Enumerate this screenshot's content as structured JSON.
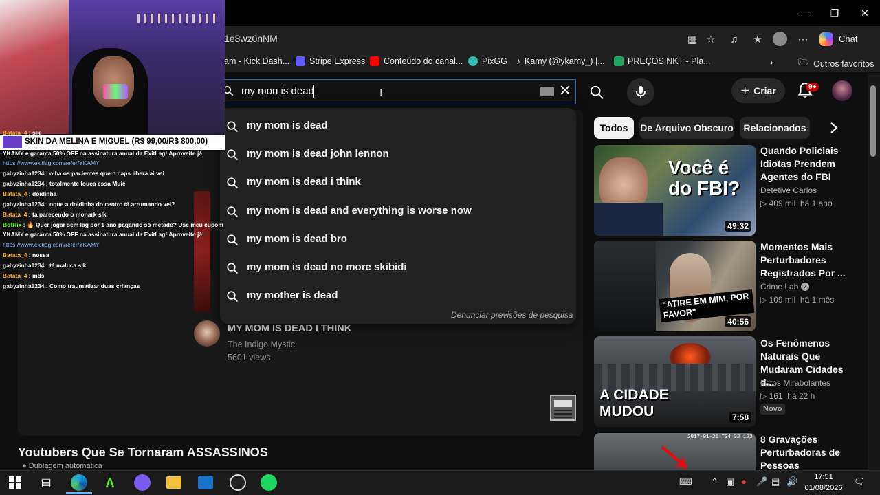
{
  "browser": {
    "url": "1e8wz0nNM",
    "chat_label": "Chat",
    "bookmarks": [
      "am - Kick Dash...",
      "Stripe Express",
      "Conteúdo do canal...",
      "PixGG",
      "Kamy (@ykamy_) |...",
      "PREÇOS NKT - Pla...",
      "Outros favoritos"
    ],
    "bookmark_colors": [
      "#53fc18",
      "#635bff",
      "#ff0000",
      "#32bcad",
      "#ffffff",
      "#1fa463",
      "#e6e6e6"
    ]
  },
  "youtube": {
    "search_value": "my mon is dead",
    "create_label": "Criar",
    "notification_badge": "9+",
    "suggestions": [
      "my mom is dead",
      "my mom is dead john lennon",
      "my mom is dead i think",
      "my mom is dead and everything is worse now",
      "my mom is dead bro",
      "my mom is dead no more skibidi",
      "my mother is dead"
    ],
    "report_link": "Denunciar previsões de pesquisa",
    "video": {
      "title": "MY MOM IS DEAD I THINK",
      "channel": "The Indigo Mystic",
      "views": "5601 views"
    },
    "section_title": "Youtubers Que Se Tornaram ASSASSINOS",
    "section_sub": "Dublagem automática",
    "chips": [
      "Todos",
      "De Arquivo Obscuro",
      "Relacionados"
    ],
    "recommended": [
      {
        "title": "Quando Policiais Idiotas Prendem Agentes do FBI",
        "channel": "Detetive Carlos",
        "views": "409 mil",
        "age": "há 1 ano",
        "duration": "49:32",
        "thumb_text": "Você é do FBI?",
        "verified": false,
        "badge": ""
      },
      {
        "title": "Momentos Mais Perturbadores Registrados Por ...",
        "channel": "Crime Lab",
        "views": "109 mil",
        "age": "há 1 mês",
        "duration": "40:56",
        "thumb_text": "\"ATIRE EM MIM, POR FAVOR\"",
        "verified": true,
        "badge": ""
      },
      {
        "title": "Os Fenômenos Naturais Que Mudaram Cidades d...",
        "channel": "Fatos Mirabolantes",
        "views": "161",
        "age": "há 22 h",
        "duration": "7:58",
        "thumb_text": "A CIDADE MUDOU",
        "verified": false,
        "badge": "Novo"
      },
      {
        "title": "8 Gravações Perturbadoras de Pessoas",
        "channel": "",
        "views": "",
        "age": "",
        "duration": "",
        "thumb_text": "2017-01-21 T04 32 122",
        "verified": false,
        "badge": ""
      }
    ]
  },
  "stream_overlay": {
    "skin_text": "SKIN DA MELINA E MIGUEL (R$ 99,00/R$ 800,00)",
    "chat": [
      {
        "user": "Batata_4",
        "msg": "slk",
        "kind": "u2"
      },
      {
        "user": "",
        "msg": "YKAMY e garanta 50% OFF na assinatura anual da ExitLag! Aproveite já:",
        "kind": "text"
      },
      {
        "user": "",
        "msg": "https://www.exitlag.com/refer/YKAMY",
        "kind": "link"
      },
      {
        "user": "gabyzinha1234",
        "msg": "olha os pacientes que o caps libera ai vei",
        "kind": "u1"
      },
      {
        "user": "gabyzinha1234",
        "msg": "totalmente louca essa Muié",
        "kind": "u1"
      },
      {
        "user": "Batata_4",
        "msg": "doidinha",
        "kind": "u2"
      },
      {
        "user": "gabyzinha1234",
        "msg": "oque a doidinha do centro tá arrumando vei?",
        "kind": "u1"
      },
      {
        "user": "Batata_4",
        "msg": "ta parecendo o monark slk",
        "kind": "u2"
      },
      {
        "user": "BotRix",
        "msg": "🔥 Quer jogar sem lag por 1 ano pagando só metade? Use meu cupom",
        "kind": "u3"
      },
      {
        "user": "",
        "msg": "YKAMY e garanta 50% OFF na assinatura anual da ExitLag! Aproveite já:",
        "kind": "text"
      },
      {
        "user": "",
        "msg": "https://www.exitlag.com/refer/YKAMY",
        "kind": "link"
      },
      {
        "user": "Batata_4",
        "msg": "nossa",
        "kind": "u2"
      },
      {
        "user": "gabyzinha1234",
        "msg": "tá maluca slk",
        "kind": "u1"
      },
      {
        "user": "Batata_4",
        "msg": "mds",
        "kind": "u2"
      },
      {
        "user": "gabyzinha1234",
        "msg": "Como traumatizar duas crianças",
        "kind": "u1"
      }
    ]
  },
  "taskbar": {
    "time": "17:51",
    "date": "01/08/2026"
  }
}
